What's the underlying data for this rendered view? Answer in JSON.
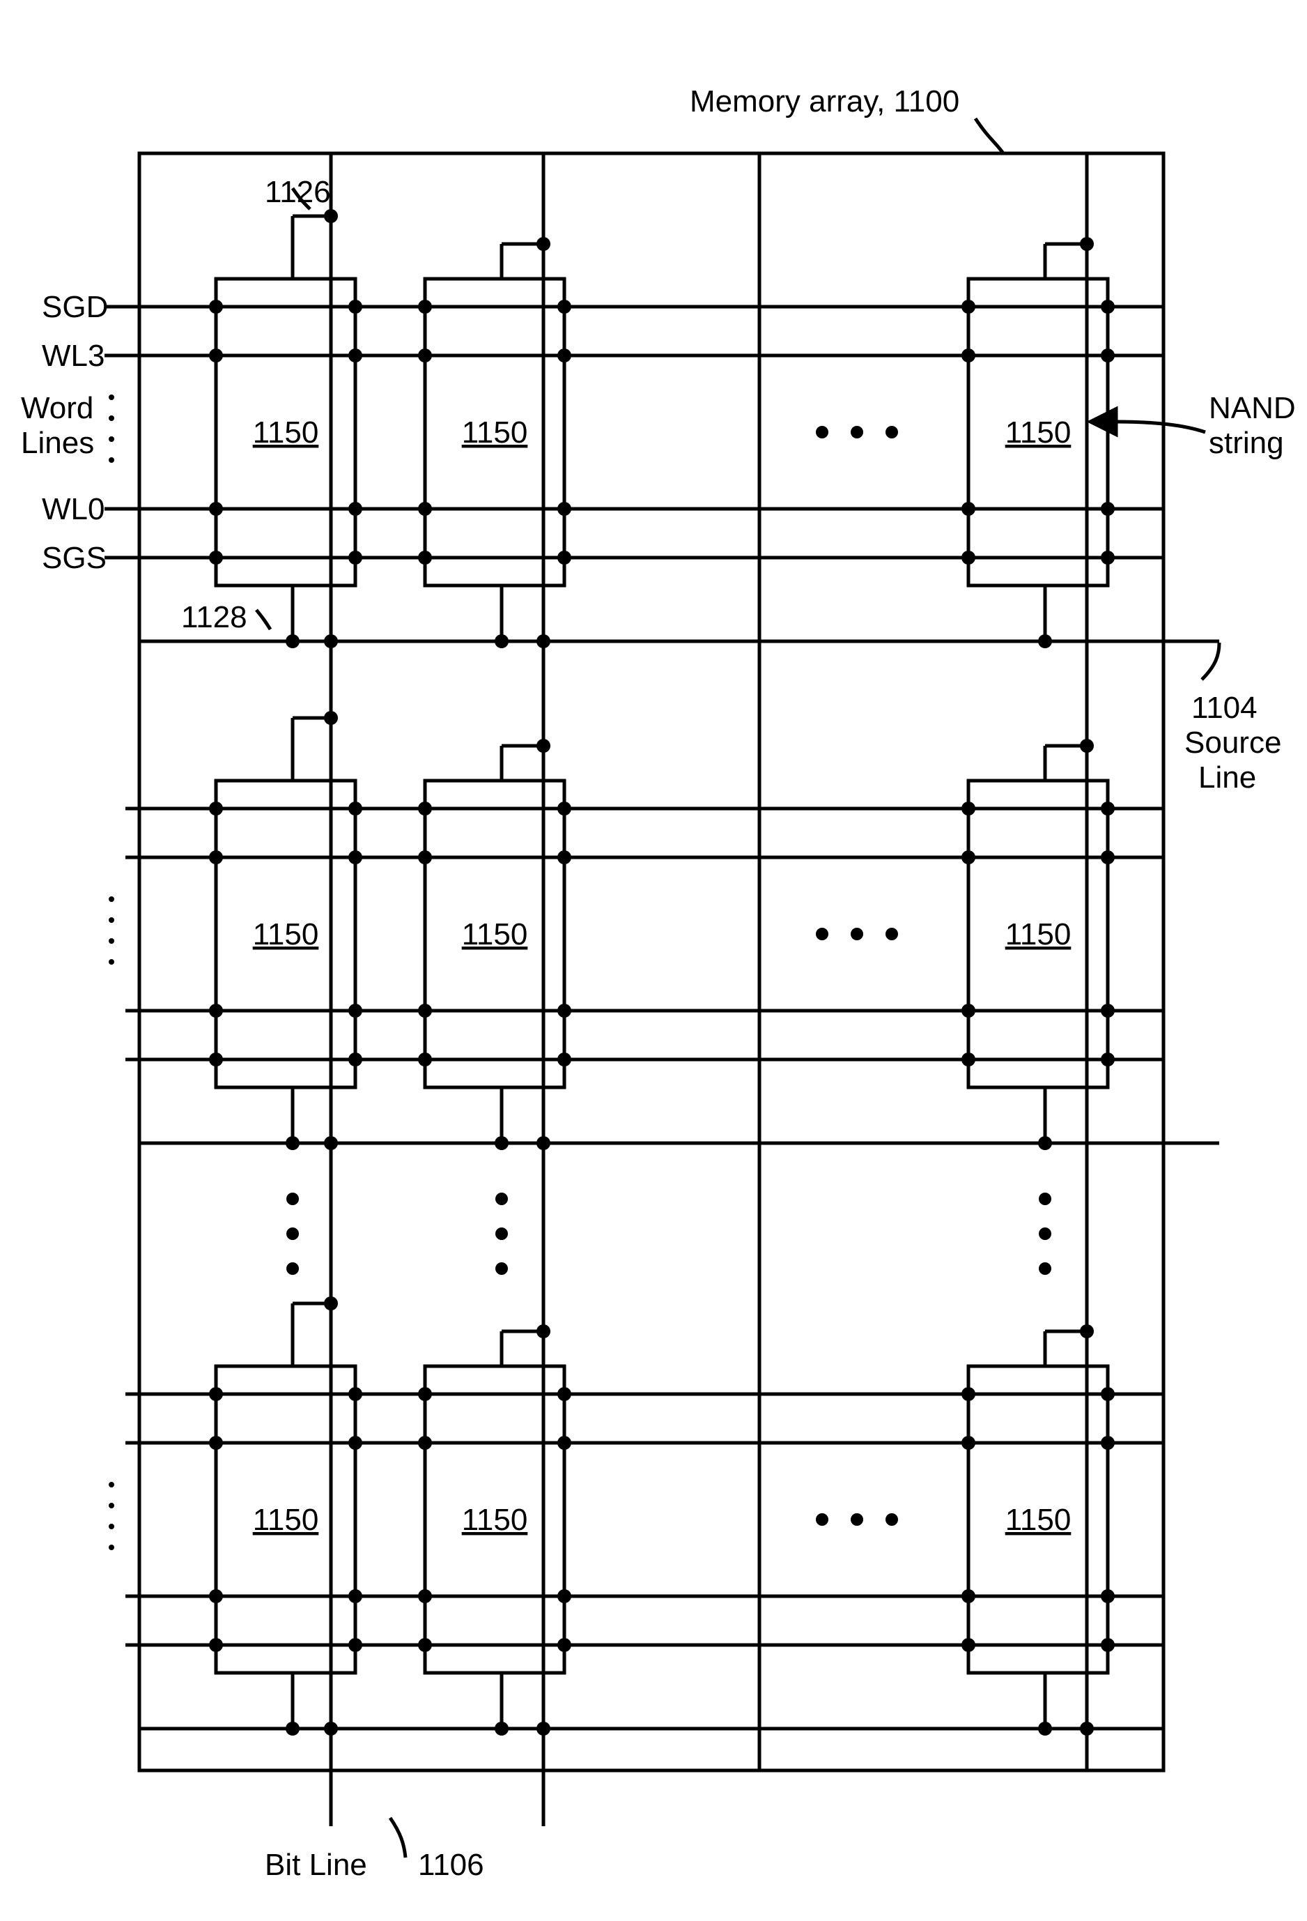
{
  "title": "Memory array, 1100",
  "block_label": "1150",
  "labels": {
    "sgd": "SGD",
    "wl3": "WL3",
    "wordlines": "Word\nLines",
    "wl0": "WL0",
    "sgs": "SGS",
    "nand_string": "NAND\nstring",
    "source_line": "1104\nSource\nLine",
    "bit_line": "Bit Line"
  },
  "refs": {
    "top_bl_tap": "1126",
    "bottom_sl_tap": "1128",
    "bit_line": "1106"
  },
  "rows": 3,
  "cols_shown": 3
}
